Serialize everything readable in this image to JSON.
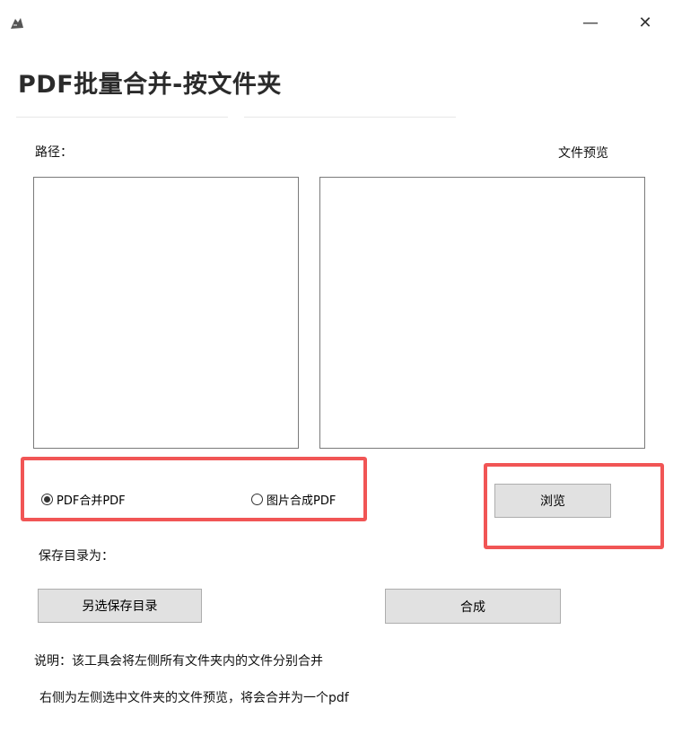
{
  "window": {
    "minimize_glyph": "—",
    "close_glyph": "✕"
  },
  "page": {
    "title": "PDF批量合并-按文件夹"
  },
  "labels": {
    "path": "路径：",
    "file_preview": "文件预览",
    "save_dir": "保存目录为："
  },
  "modes": {
    "options": [
      {
        "label": "PDF合并PDF",
        "checked": true
      },
      {
        "label": "图片合成PDF",
        "checked": false
      }
    ]
  },
  "buttons": {
    "browse": "浏览",
    "choose_save_dir": "另选保存目录",
    "merge": "合成"
  },
  "notes": {
    "line1": "说明：该工具会将左侧所有文件夹内的文件分别合并",
    "line2": "右侧为左侧选中文件夹的文件预览，将会合并为一个pdf"
  },
  "highlight_color": "#f15555"
}
